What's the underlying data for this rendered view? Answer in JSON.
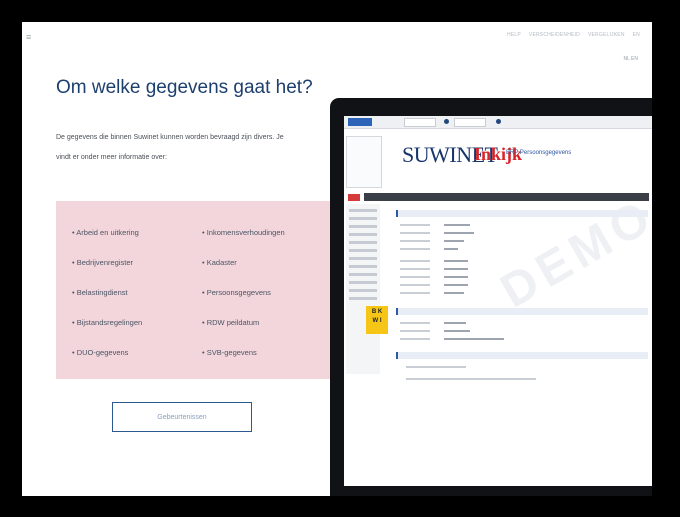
{
  "header": {
    "menu_icon": "hamburger-icon",
    "nav": [
      "HELP",
      "VERSCHEIDENHEID",
      "VERGELIJKEN",
      "EN"
    ],
    "language": "NL EN"
  },
  "main": {
    "title": "Om welke gegevens gaat het?",
    "intro": "De gegevens die binnen Suwinet kunnen worden bevraagd zijn divers. Je vindt er onder meer informatie over:",
    "categories_left": [
      "Arbeid en uitkering",
      "Bedrijvenregister",
      "Belastingdienst",
      "Bijstandsregelingen",
      "DUO-gegevens"
    ],
    "categories_right": [
      "Inkomensverhoudingen",
      "Kadaster",
      "Persoonsgegevens",
      "RDW peildatum",
      "SVB-gegevens"
    ],
    "cta_label": "Gebeurtenissen"
  },
  "mockup": {
    "logo": "SUWINET",
    "logo_accent": "Inkijk",
    "subtitle": "BRP Persoonsgegevens",
    "badge": "BKWI",
    "stamp": "DEMO"
  },
  "colors": {
    "title": "#1d3f6e",
    "pink_panel": "#f3d6dc",
    "cta_border": "#2d5a8e",
    "logo_blue": "#17356b",
    "logo_red": "#d9252a",
    "badge_yellow": "#f5c518"
  }
}
